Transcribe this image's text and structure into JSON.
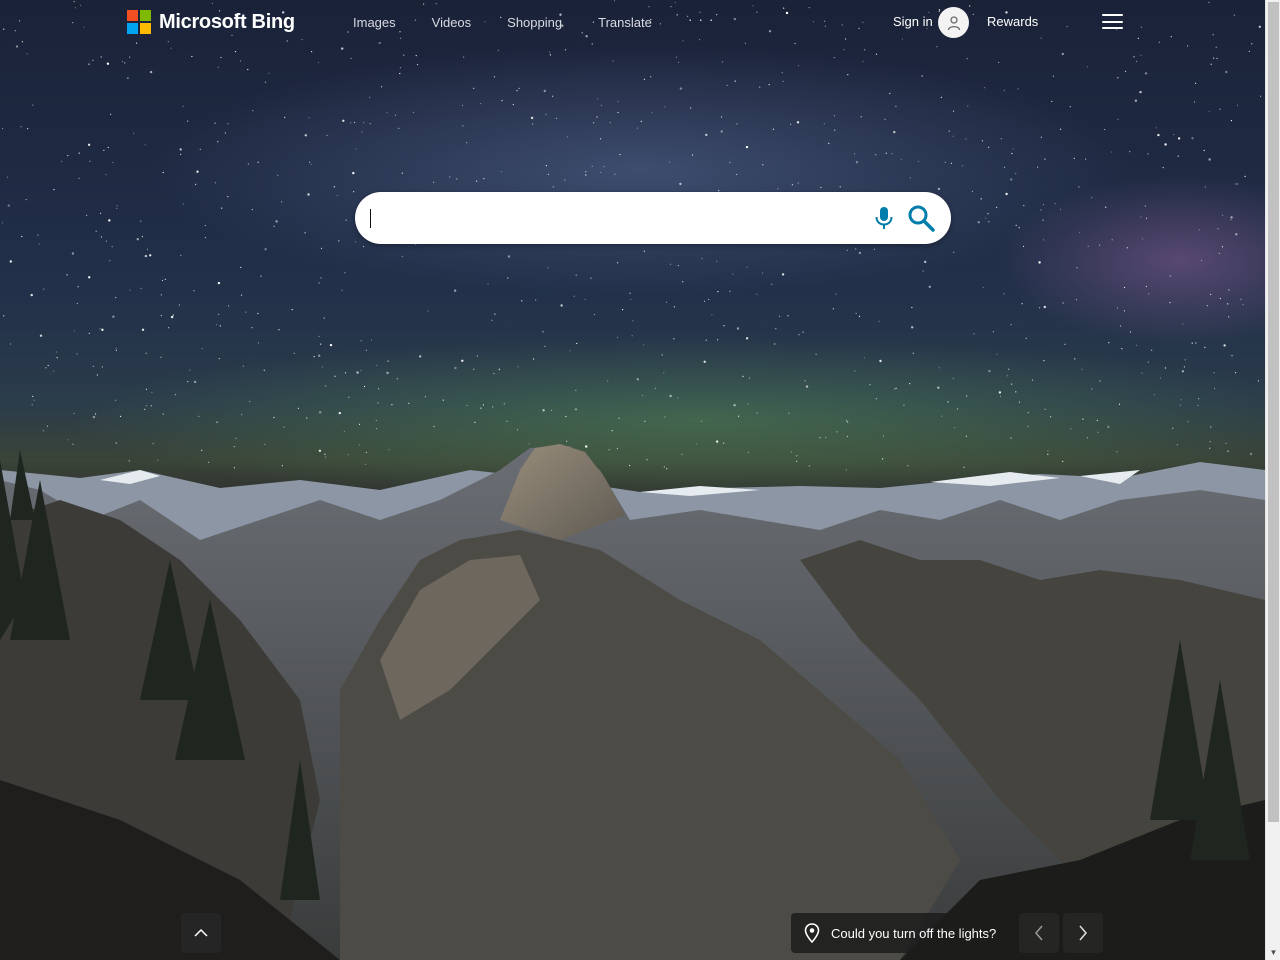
{
  "brand": {
    "name": "Microsoft Bing"
  },
  "nav": {
    "items": [
      {
        "label": "Images"
      },
      {
        "label": "Videos"
      },
      {
        "label": "Shopping"
      },
      {
        "label": "Translate"
      }
    ],
    "more_label": "· · ·"
  },
  "account": {
    "signin_label": "Sign in",
    "rewards_label": "Rewards"
  },
  "search": {
    "value": "",
    "placeholder": ""
  },
  "image_info": {
    "caption": "Could you turn off the lights?"
  },
  "icons": {
    "menu": "hamburger-icon",
    "mic": "microphone-icon",
    "search": "search-icon",
    "location": "location-pin-icon",
    "up": "chevron-up-icon",
    "prev": "chevron-left-icon",
    "next": "chevron-right-icon",
    "avatar": "user-icon"
  },
  "colors": {
    "accent": "#007daa",
    "ms_red": "#f25022",
    "ms_green": "#7fba00",
    "ms_blue": "#00a4ef",
    "ms_yellow": "#ffb900"
  }
}
